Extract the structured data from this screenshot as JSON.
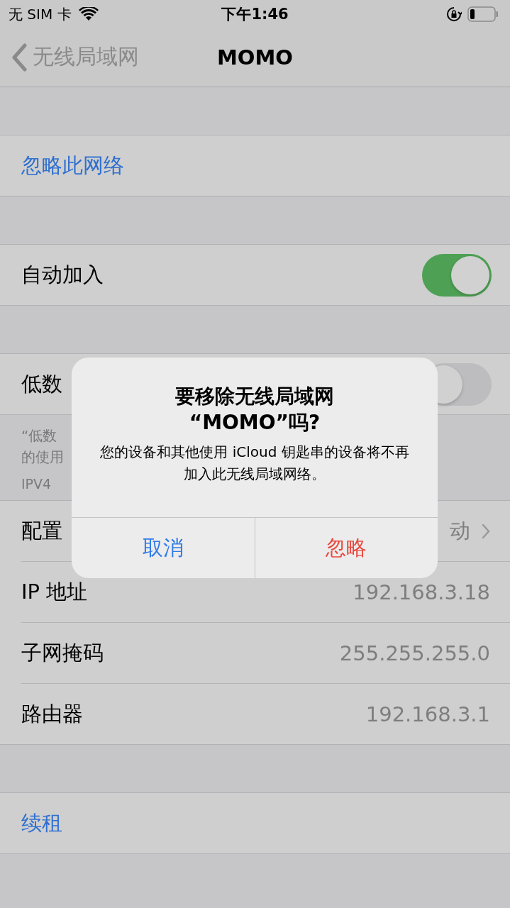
{
  "status_bar": {
    "carrier": "无 SIM 卡",
    "time": "下午1:46"
  },
  "nav": {
    "back": "无线局域网",
    "title": "MOMO"
  },
  "groups": [
    {
      "rows": [
        {
          "kind": "link",
          "label": "忽略此网络"
        }
      ]
    },
    {
      "rows": [
        {
          "kind": "toggle",
          "label": "自动加入",
          "on": true
        }
      ]
    },
    {
      "rows": [
        {
          "kind": "toggle",
          "label": "低数",
          "on": false
        }
      ],
      "footer": [
        "“低数",
        "的使用"
      ]
    },
    {
      "header": "IPV4",
      "rows": [
        {
          "kind": "value",
          "label": "配置",
          "value": "动",
          "chevron": true
        },
        {
          "kind": "value",
          "label": "IP 地址",
          "value": "192.168.3.18"
        },
        {
          "kind": "value",
          "label": "子网掩码",
          "value": "255.255.255.0"
        },
        {
          "kind": "value",
          "label": "路由器",
          "value": "192.168.3.1"
        }
      ]
    },
    {
      "rows": [
        {
          "kind": "link",
          "label": "续租"
        }
      ]
    }
  ],
  "alert": {
    "title": [
      "要移除无线局域网",
      "“MOMO”吗?"
    ],
    "message": "您的设备和其他使用 iCloud 钥匙串的设备将不再加入此无线局域网络。",
    "buttons": [
      {
        "label": "取消",
        "kind": "default"
      },
      {
        "label": "忽略",
        "kind": "destructive"
      }
    ]
  }
}
